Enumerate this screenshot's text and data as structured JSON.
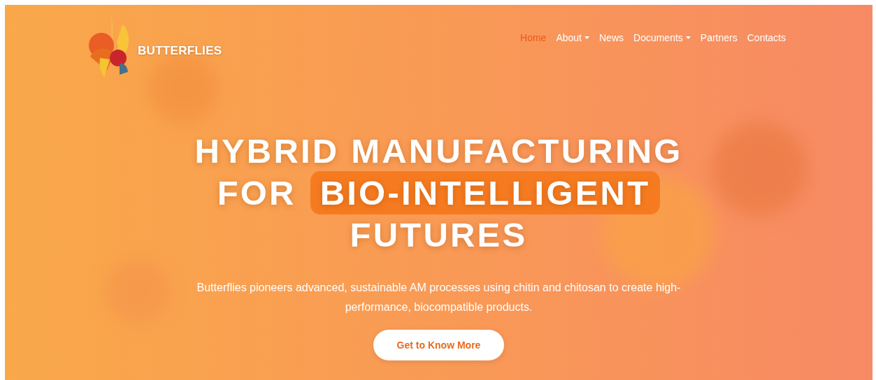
{
  "logo": {
    "text": "BUTTERFLIES"
  },
  "nav": [
    {
      "label": "Home",
      "selected": true,
      "dropdown": false
    },
    {
      "label": "About",
      "selected": false,
      "dropdown": true
    },
    {
      "label": "News",
      "selected": false,
      "dropdown": false
    },
    {
      "label": "Documents",
      "selected": false,
      "dropdown": true
    },
    {
      "label": "Partners",
      "selected": false,
      "dropdown": false
    },
    {
      "label": "Contacts",
      "selected": false,
      "dropdown": false
    }
  ],
  "headline": {
    "line_1": "HYBRID MANUFACTURING",
    "line_2": "FOR",
    "highlight": "BIO-INTELLIGENT",
    "line_3": "FUTURES"
  },
  "description": "Butterflies pioneers advanced, sustainable AM processes using chitin and chitosan to create high-performance, biocompatible products.",
  "cta": {
    "label": "Get to Know More"
  }
}
